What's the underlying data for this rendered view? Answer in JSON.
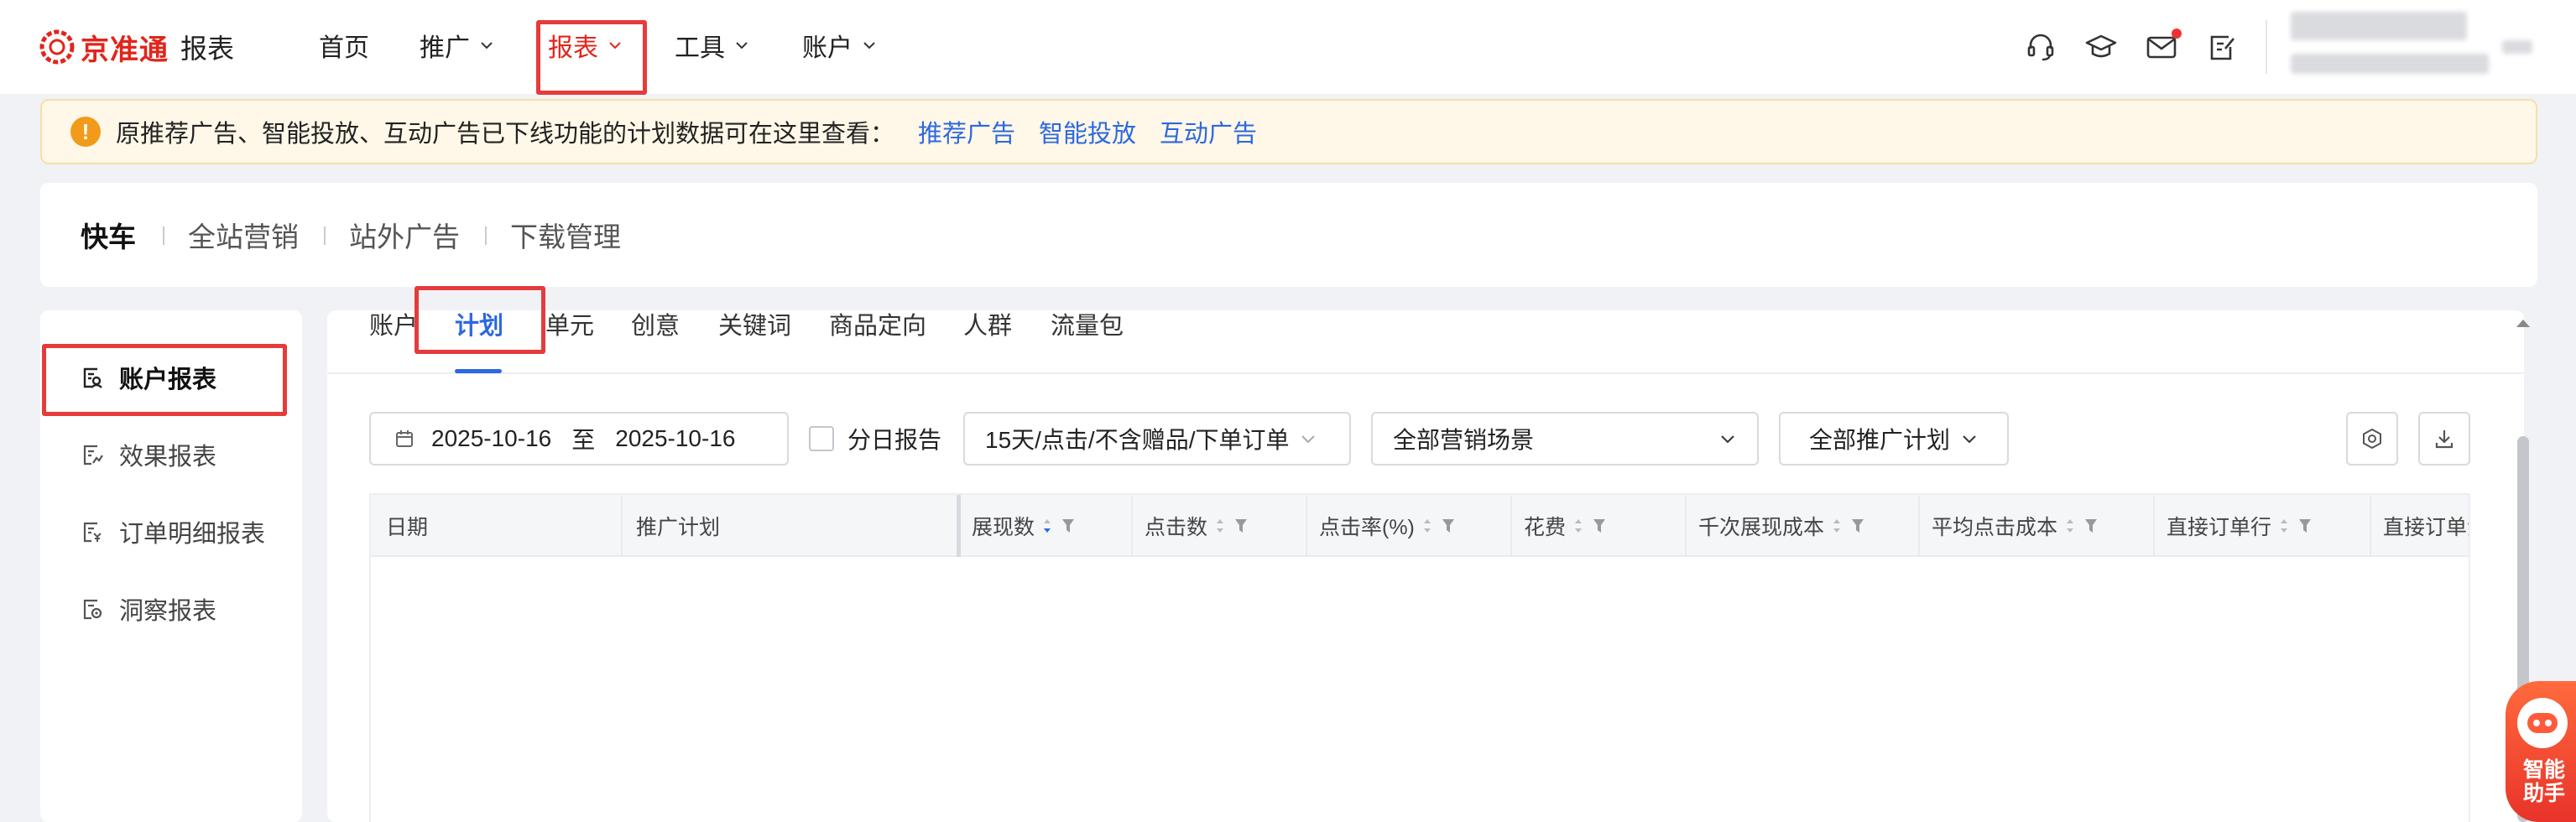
{
  "brand": {
    "name": "京准通",
    "section": "报表",
    "color": "#e1251b"
  },
  "nav": [
    {
      "label": "首页",
      "has_menu": false,
      "active": false
    },
    {
      "label": "推广",
      "has_menu": true,
      "active": false
    },
    {
      "label": "报表",
      "has_menu": true,
      "active": true
    },
    {
      "label": "工具",
      "has_menu": true,
      "active": false
    },
    {
      "label": "账户",
      "has_menu": true,
      "active": false
    }
  ],
  "top_icons": [
    "headset-icon",
    "graduation-cap-icon",
    "mail-icon",
    "clipboard-edit-icon"
  ],
  "notice": {
    "text": "原推荐广告、智能投放、互动广告已下线功能的计划数据可在这里查看：",
    "links": [
      "推荐广告",
      "智能投放",
      "互动广告"
    ]
  },
  "product_tabs": [
    {
      "label": "快车",
      "active": true
    },
    {
      "label": "全站营销",
      "active": false
    },
    {
      "label": "站外广告",
      "active": false
    },
    {
      "label": "下载管理",
      "active": false
    }
  ],
  "sidebar": [
    {
      "label": "账户报表",
      "icon": "account-report-icon",
      "active": true
    },
    {
      "label": "效果报表",
      "icon": "effect-report-icon",
      "active": false
    },
    {
      "label": "订单明细报表",
      "icon": "order-detail-icon",
      "active": false
    },
    {
      "label": "洞察报表",
      "icon": "insight-report-icon",
      "active": false
    }
  ],
  "report_tabs": [
    {
      "label": "账户",
      "active": false
    },
    {
      "label": "计划",
      "active": true
    },
    {
      "label": "单元",
      "active": false
    },
    {
      "label": "创意",
      "active": false
    },
    {
      "label": "关键词",
      "active": false
    },
    {
      "label": "商品定向",
      "active": false
    },
    {
      "label": "人群",
      "active": false
    },
    {
      "label": "流量包",
      "active": false
    }
  ],
  "filters": {
    "date_start": "2025-10-16",
    "date_sep": "至",
    "date_end": "2025-10-16",
    "daily_report_label": "分日报告",
    "daily_report_checked": false,
    "attribution": "15天/点击/不含赠品/下单订单",
    "scene": "全部营销场景",
    "plan": "全部推广计划"
  },
  "table": {
    "columns": [
      {
        "label": "日期",
        "sortable": false,
        "filterable": false
      },
      {
        "label": "推广计划",
        "sortable": false,
        "filterable": false
      },
      {
        "label": "展现数",
        "sortable": true,
        "filterable": true,
        "sort": "desc"
      },
      {
        "label": "点击数",
        "sortable": true,
        "filterable": true
      },
      {
        "label": "点击率(%)",
        "sortable": true,
        "filterable": true
      },
      {
        "label": "花费",
        "sortable": true,
        "filterable": true
      },
      {
        "label": "千次展现成本",
        "sortable": true,
        "filterable": true
      },
      {
        "label": "平均点击成本",
        "sortable": true,
        "filterable": true
      },
      {
        "label": "直接订单行",
        "sortable": true,
        "filterable": true
      },
      {
        "label": "直接订单金额",
        "sortable": false,
        "filterable": false
      }
    ],
    "rows": []
  },
  "assistant": {
    "label_line1": "智能",
    "label_line2": "助手"
  },
  "colors": {
    "accent": "#2c68e0",
    "highlight": "#e63b3b",
    "notice_bg": "#fff8e8",
    "warning": "#f29a1a"
  }
}
